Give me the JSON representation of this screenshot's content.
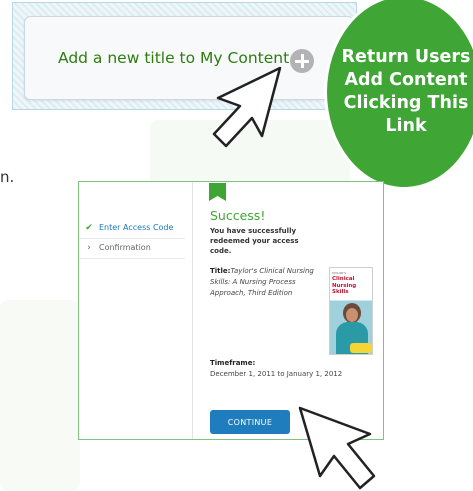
{
  "add_title": {
    "label": "Add a new title to My Content",
    "icon": "plus-circle-icon"
  },
  "callout": {
    "text": "Return Users Add Content Clicking This Link",
    "color": "#3fa535"
  },
  "stray_text": "n.",
  "wizard": {
    "steps": [
      {
        "label": "Enter Access Code",
        "state": "done",
        "mark": "✔"
      },
      {
        "label": "Confirmation",
        "state": "pending",
        "mark": "›"
      }
    ]
  },
  "success": {
    "title": "Success!",
    "message": "You have successfully redeemed your access code.",
    "title_label": "Title:",
    "book_title": "Taylor's Clinical Nursing Skills: A Nursing Process Approach, Third Edition",
    "book_cover": {
      "small_text": "TAYLOR'S",
      "title": "Clinical Nursing Skills"
    },
    "timeframe_label": "Timeframe:",
    "timeframe_value": "December 1, 2011 to January 1, 2012",
    "continue_label": "CONTINUE"
  },
  "colors": {
    "accent_green": "#3fa535",
    "link_blue": "#1a78b4",
    "button_blue": "#1f7dbd"
  }
}
